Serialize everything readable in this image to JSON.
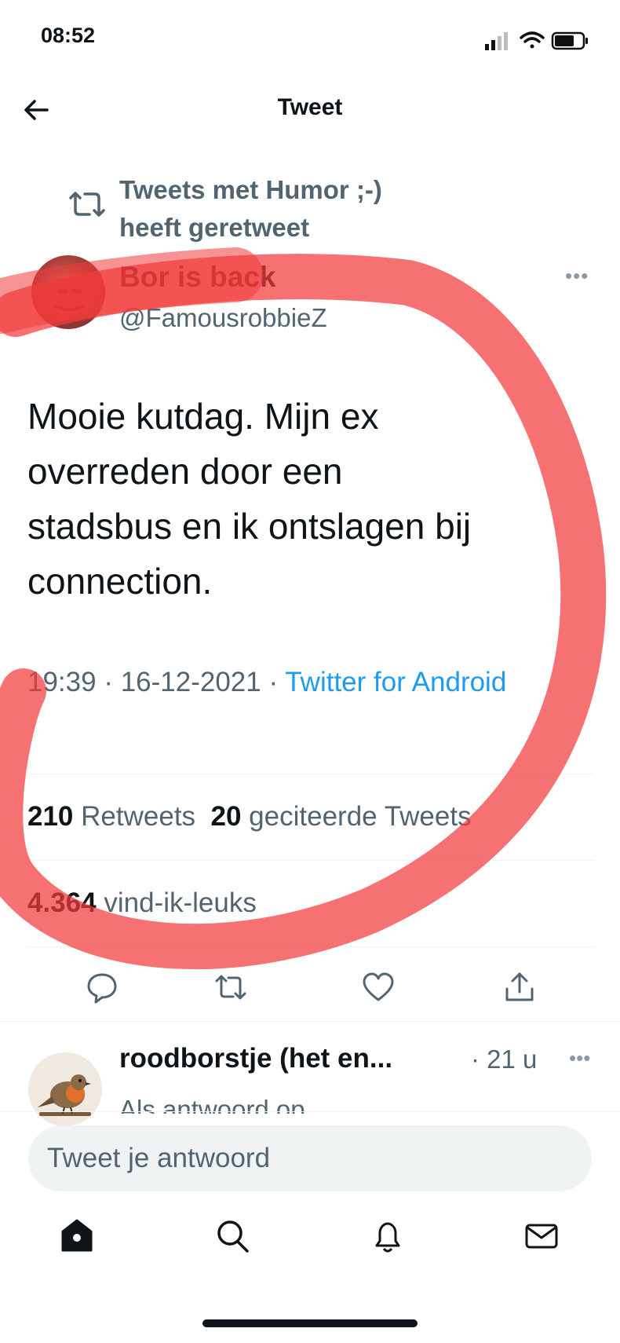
{
  "status_bar": {
    "time": "08:52"
  },
  "header": {
    "title": "Tweet"
  },
  "retweet": {
    "line1": "Tweets met Humor ;-)",
    "line2": "heeft geretweet"
  },
  "author": {
    "name": "Bor is back",
    "handle": "@FamousrobbieZ"
  },
  "tweet": {
    "lines": [
      "Mooie kutdag. Mijn ex",
      "overreden door een",
      "stadsbus en ik ontslagen bij",
      "connection."
    ],
    "time": "19:39",
    "date": "16-12-2021",
    "source": "Twitter for Android"
  },
  "stats": {
    "retweets_count": "210",
    "retweets_label": "Retweets",
    "quotes_count": "20",
    "quotes_label": "geciteerde Tweets",
    "likes_count": "4.364",
    "likes_label": "vind-ik-leuks"
  },
  "reply": {
    "name": "roodborstje (het en...",
    "time": "· 21 u",
    "subtitle": "Als antwoord op"
  },
  "compose": {
    "placeholder": "Tweet je antwoord"
  },
  "colors": {
    "accent": "#1d9bf0",
    "secondary_text": "#536471",
    "scribble": "#f23b3b"
  },
  "icons": {
    "actions": [
      "reply-icon",
      "retweet-icon",
      "like-icon",
      "share-icon"
    ],
    "nav": [
      "home-icon",
      "search-icon",
      "notifications-icon",
      "messages-icon"
    ]
  }
}
